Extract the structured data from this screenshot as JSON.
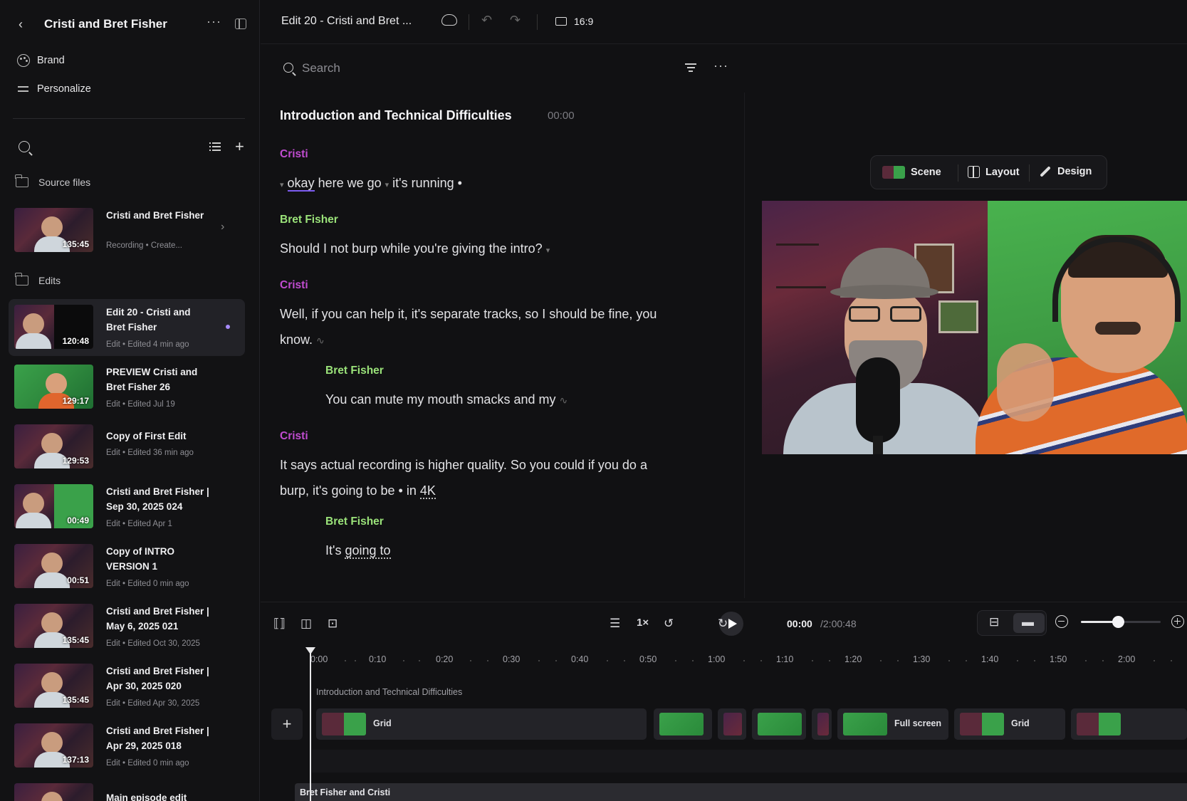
{
  "sidebar": {
    "title": "Cristi and Bret Fisher",
    "nav": [
      {
        "label": "Brand",
        "icon": "palette-icon"
      },
      {
        "label": "Personalize",
        "icon": "sliders-icon"
      }
    ],
    "source_files_label": "Source files",
    "source_item": {
      "title": "Cristi and Bret Fisher",
      "duration": "135:45",
      "sub": "Recording • Create..."
    },
    "edits_label": "Edits",
    "edits": [
      {
        "title": "Edit 20 - Cristi and Bret Fisher",
        "duration": "120:48",
        "sub": "Edit • Edited 4 min ago"
      },
      {
        "title": "PREVIEW Cristi and Bret Fisher 26",
        "duration": "129:17",
        "sub": "Edit • Edited Jul 19"
      },
      {
        "title": "Copy of First Edit",
        "duration": "129:53",
        "sub": "Edit • Edited 36 min ago"
      },
      {
        "title": "Cristi and Bret Fisher | Sep 30, 2025 024",
        "duration": "00:49",
        "sub": "Edit • Edited Apr 1"
      },
      {
        "title": "Copy of INTRO VERSION 1",
        "duration": "00:51",
        "sub": "Edit • Edited 0 min ago"
      },
      {
        "title": "Cristi and Bret Fisher | May 6, 2025 021",
        "duration": "135:45",
        "sub": "Edit • Edited Oct 30, 2025"
      },
      {
        "title": "Cristi and Bret Fisher | Apr 30, 2025 020",
        "duration": "135:45",
        "sub": "Edit • Edited Apr 30, 2025"
      },
      {
        "title": "Cristi and Bret Fisher | Apr 29, 2025 018",
        "duration": "137:13",
        "sub": "Edit • Edited 0 min ago"
      },
      {
        "title": "Main episode edit",
        "duration": "",
        "sub": ""
      }
    ]
  },
  "topbar": {
    "doc_title": "Edit 20 - Cristi and Bret ...",
    "aspect_ratio": "16:9"
  },
  "search": {
    "placeholder": "Search"
  },
  "transcript": {
    "section_title": "Introduction and Technical Difficulties",
    "section_time": "00:00",
    "blocks": [
      {
        "speaker": "Cristi",
        "parts": [
          "okay",
          " here we go ",
          " it's running "
        ]
      },
      {
        "speaker": "Bret Fisher",
        "text": "Should I not burp while you're giving the intro?"
      },
      {
        "speaker": "Cristi",
        "text1": "Well, if you can help it, it's separate tracks, so I should be fine, you",
        "text2": "know."
      },
      {
        "speaker": "Bret Fisher",
        "text": "You can mute my mouth smacks and my"
      },
      {
        "speaker": "Cristi",
        "text1": "It says actual recording is higher quality. So you could if you do a",
        "text2a": "burp, it's going to be ",
        "text2b": " in ",
        "text2c": "4K"
      },
      {
        "speaker": "Bret Fisher",
        "text_a": "It's ",
        "text_b": "going to"
      }
    ]
  },
  "preview_toolbar": {
    "scene": "Scene",
    "layout": "Layout",
    "design": "Design"
  },
  "playback": {
    "speed": "1×",
    "current": "00:00",
    "total": "/2:00:48"
  },
  "timeline": {
    "ticks": [
      "0:00",
      "0:10",
      "0:20",
      "0:30",
      "0:40",
      "0:50",
      "1:00",
      "1:10",
      "1:20",
      "1:30",
      "1:40",
      "1:50",
      "2:00"
    ],
    "chapter": "Introduction and Technical Difficulties",
    "clips": [
      {
        "label": "Grid"
      },
      {
        "label": ""
      },
      {
        "label": ""
      },
      {
        "label": ""
      },
      {
        "label": ""
      },
      {
        "label": "Full screen"
      },
      {
        "label": "Grid"
      },
      {
        "label": ""
      }
    ],
    "bottom_track": "Bret Fisher and Cristi"
  },
  "colors": {
    "accent_purple": "#7c5cf0",
    "speaker_cristi": "#c04cd0",
    "speaker_bret": "#9be37a"
  }
}
